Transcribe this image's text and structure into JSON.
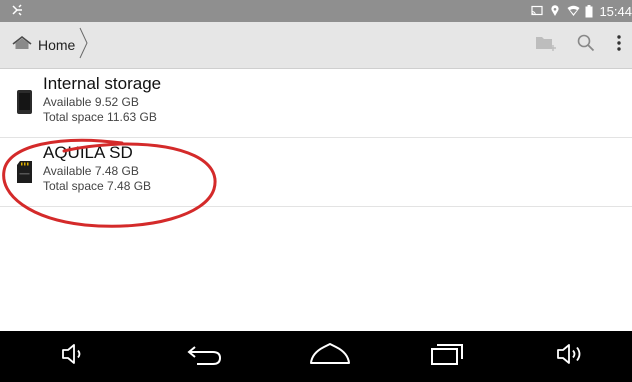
{
  "status_bar": {
    "time": "15:44",
    "left_icon": "usb-debug-icon",
    "right_icons": [
      "cast-icon",
      "location-icon",
      "wifi-icon",
      "battery-icon"
    ],
    "background": "#8f8f8f"
  },
  "action_bar": {
    "breadcrumb": {
      "icon": "home-icon",
      "label": "Home"
    },
    "actions": [
      "new-folder-icon",
      "search-icon",
      "overflow-menu-icon"
    ],
    "background": "#e6e6e6"
  },
  "storage": {
    "items": [
      {
        "icon": "phone-device-icon",
        "title": "Internal storage",
        "available": "Available 9.52 GB",
        "total": "Total space 11.63 GB"
      },
      {
        "icon": "sd-card-icon",
        "title": "AQUILA SD",
        "available": "Available 7.48 GB",
        "total": "Total space 7.48 GB"
      }
    ]
  },
  "annotation": {
    "shape": "red-freehand-ellipse",
    "color": "#d42a2a"
  },
  "nav_bar": {
    "buttons": [
      "volume-down-icon",
      "back-icon",
      "home-icon",
      "recents-icon",
      "volume-up-icon"
    ],
    "background": "#000000"
  }
}
